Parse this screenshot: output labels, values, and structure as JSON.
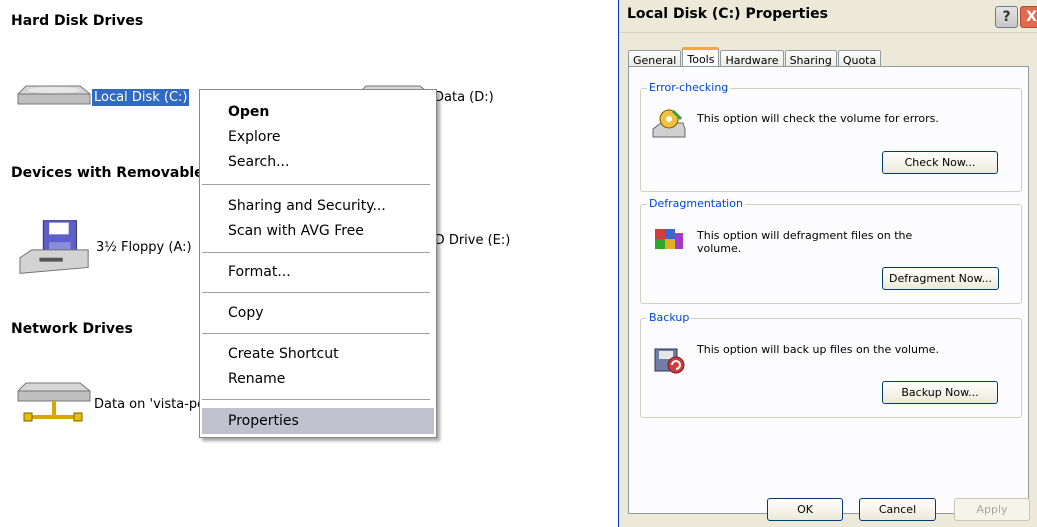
{
  "explorer": {
    "groups": {
      "hard_disk": "Hard Disk Drives",
      "removable": "Devices with Removable Storage",
      "network": "Network Drives"
    },
    "drives": {
      "local_c": "Local Disk (C:)",
      "data_d": "Data (D:)",
      "floppy": "3½ Floppy (A:)",
      "dvd": "DVD Drive (E:)",
      "network_data": "Data on 'vista-pc'"
    }
  },
  "context_menu": {
    "open": "Open",
    "explore": "Explore",
    "search": "Search...",
    "sharing": "Sharing and Security...",
    "scan": "Scan with AVG Free",
    "format": "Format...",
    "copy": "Copy",
    "create_shortcut": "Create Shortcut",
    "rename": "Rename",
    "properties": "Properties"
  },
  "dialog": {
    "title": "Local Disk (C:) Properties",
    "help_glyph": "?",
    "close_glyph": "X",
    "tabs": [
      "General",
      "Tools",
      "Hardware",
      "Sharing",
      "Quota"
    ],
    "active_tab": "Tools",
    "error_checking": {
      "title": "Error-checking",
      "description": "This option will check the volume for errors.",
      "button": "Check Now..."
    },
    "defragmentation": {
      "title": "Defragmentation",
      "description": "This option will defragment files on the volume.",
      "button": "Defragment Now..."
    },
    "backup": {
      "title": "Backup",
      "description": "This option will back up files on the volume.",
      "button": "Backup Now..."
    },
    "buttons": {
      "ok": "OK",
      "cancel": "Cancel",
      "apply": "Apply"
    }
  }
}
